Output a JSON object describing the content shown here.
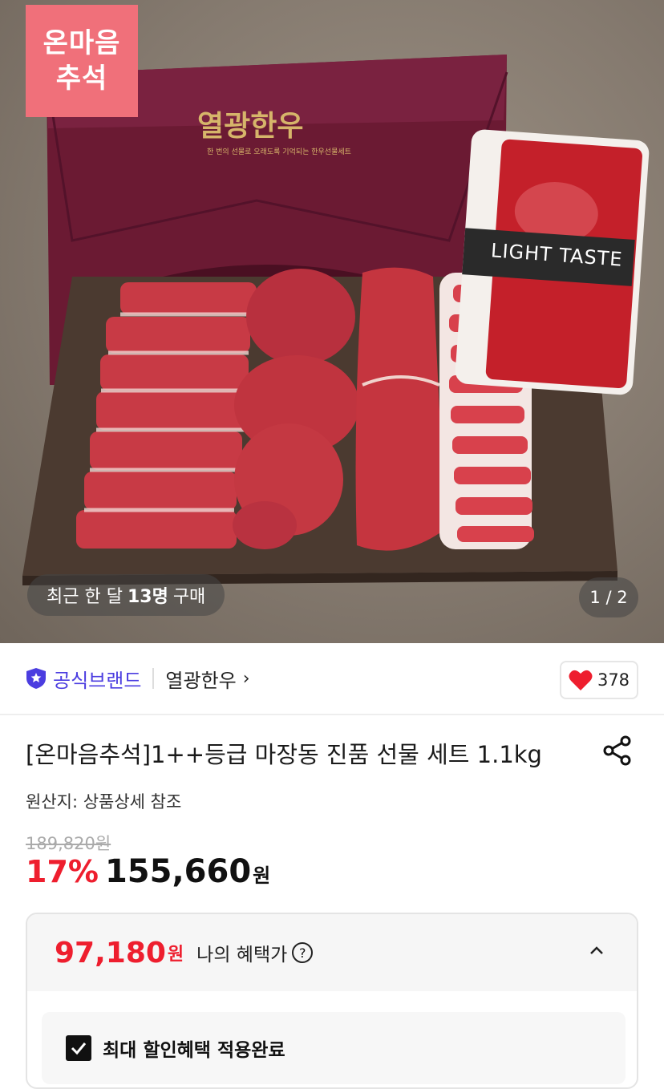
{
  "hero": {
    "badge_line1": "온마음",
    "badge_line2": "추석",
    "bag_brand": "열광한우",
    "bag_tagline": "한 번의 선물로 오래도록 기억되는 한우선물세트",
    "tray_label": "LIGHT TASTE",
    "recent_prefix": "최근 한 달",
    "recent_count": "13명",
    "recent_suffix": "구매",
    "pager": "1 / 2"
  },
  "brand": {
    "official_label": "공식브랜드",
    "name": "열광한우",
    "chevron": "›",
    "likes": "378"
  },
  "product": {
    "title": "[온마음추석]1++등급 마장동 진품 선물 세트 1.1kg",
    "origin": "원산지: 상품상세 참조",
    "original_price": "189,820원",
    "discount": "17%",
    "price": "155,660",
    "currency": "원"
  },
  "benefit": {
    "price": "97,180",
    "currency": "원",
    "label": "나의 혜택가",
    "help": "?",
    "applied_label": "최대 할인혜택 적용완료"
  },
  "colors": {
    "brand_purple": "#4b3de0",
    "discount_red": "#ee1e2e",
    "badge_pink": "#f0707a",
    "bag_maroon": "#6b1a33"
  }
}
